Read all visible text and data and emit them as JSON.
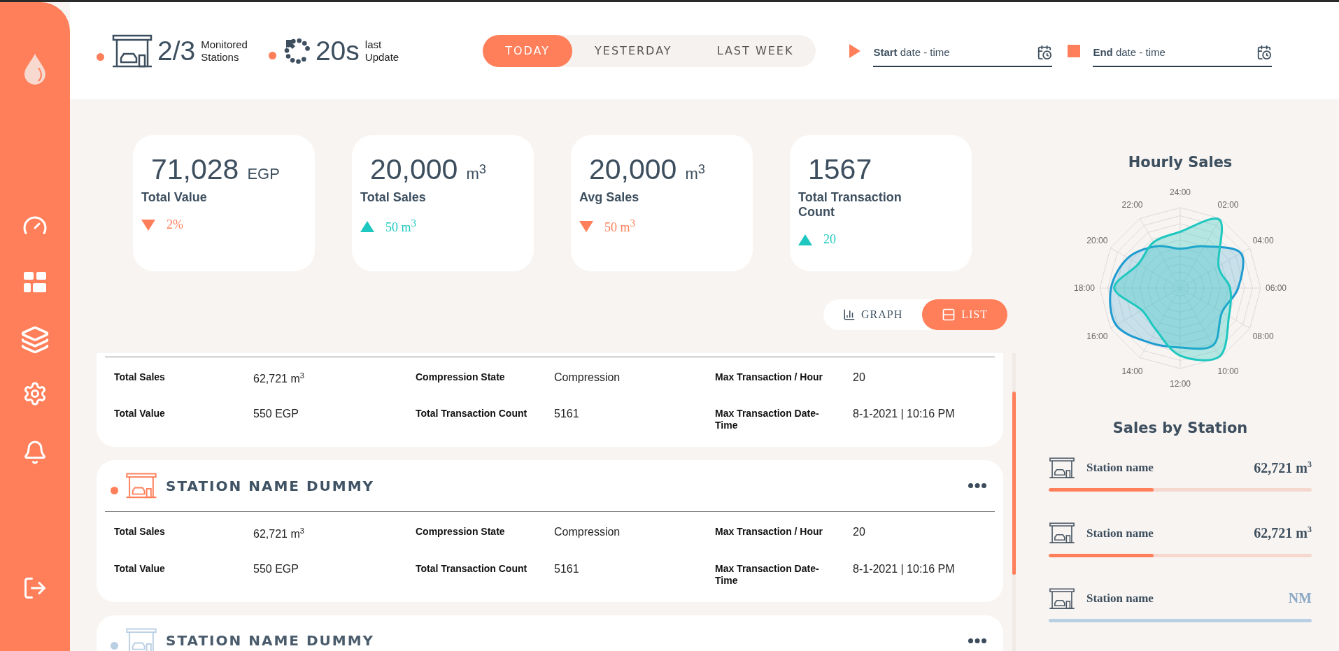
{
  "header": {
    "stats": [
      {
        "kind": "stations",
        "value": "2/3",
        "label": "Monitored Stations"
      },
      {
        "kind": "update",
        "value": "20s",
        "label": "last Update"
      }
    ],
    "period_tabs": [
      {
        "label": "TODAY",
        "selected": true
      },
      {
        "label": "YESTERDAY",
        "selected": false
      },
      {
        "label": "LAST WEEK",
        "selected": false
      }
    ],
    "date_fields": [
      {
        "kind": "start",
        "label": "**Start** date - time"
      },
      {
        "kind": "end",
        "label": "**End** date - time"
      }
    ]
  },
  "kpis": [
    {
      "value": "71,028",
      "unit": "EGP",
      "label": "Total Value",
      "increase": false,
      "change": "2%"
    },
    {
      "value": "20,000",
      "unit": "m$^{3}$",
      "label": "Total Sales",
      "increase": true,
      "change": "50 m$^{3}$"
    },
    {
      "value": "20,000",
      "unit": "m$^{3}$",
      "label": "Avg Sales",
      "increase": false,
      "change": "50 m$^{3}$"
    },
    {
      "value": "1567",
      "label": "Total Transaction Count",
      "increase": true,
      "change": "20"
    }
  ],
  "view_toggle": [
    {
      "kind": "graph",
      "label": "GRAPH",
      "selected": false
    },
    {
      "kind": "list",
      "label": "LIST",
      "selected": true
    }
  ],
  "stations": [
    {
      "fields": [
        {
          "label": "Total Sales",
          "value": "62,721 m$^{3}$"
        },
        {
          "label": "Compression State",
          "value": "Compression"
        },
        {
          "label": "Max Transaction / Hour",
          "value": "20"
        },
        {
          "label": "Total Value",
          "value": "550 EGP"
        },
        {
          "label": "Total Transaction Count",
          "value": "5161"
        },
        {
          "label": "Max Transaction Date-Time",
          "value": "8-1-2021 | 10:16 PM"
        }
      ]
    },
    {
      "name": "STATION NAME DUMMY",
      "active": true,
      "fields": [
        {
          "label": "Total Sales",
          "value": "62,721 m$^{3}$"
        },
        {
          "label": "Compression State",
          "value": "Compression"
        },
        {
          "label": "Max Transaction / Hour",
          "value": "20"
        },
        {
          "label": "Total Value",
          "value": "550 EGP"
        },
        {
          "label": "Total Transaction Count",
          "value": "5161"
        },
        {
          "label": "Max Transaction Date-Time",
          "value": "8-1-2021 | 10:16 PM"
        }
      ]
    },
    {
      "name": "STATION NAME DUMMY",
      "active": false
    }
  ],
  "hourly_sales": {
    "title": "Hourly Sales",
    "axis_labels": [
      "24:00",
      "02:00",
      "04:00",
      "06:00",
      "08:00",
      "10:00",
      "12:00",
      "14:00",
      "16:00",
      "18:00",
      "20:00",
      "22:00"
    ]
  },
  "sales_by_station": {
    "title": "Sales by Station",
    "items": [
      {
        "name": "Station name",
        "value": "62,721 m$^{3}$",
        "active": true,
        "level": 0.4
      },
      {
        "name": "Station name",
        "value": "62,721 m$^{3}$",
        "active": true,
        "level": 0.4
      },
      {
        "name": "Station name",
        "value": "NM",
        "active": false
      }
    ]
  }
}
